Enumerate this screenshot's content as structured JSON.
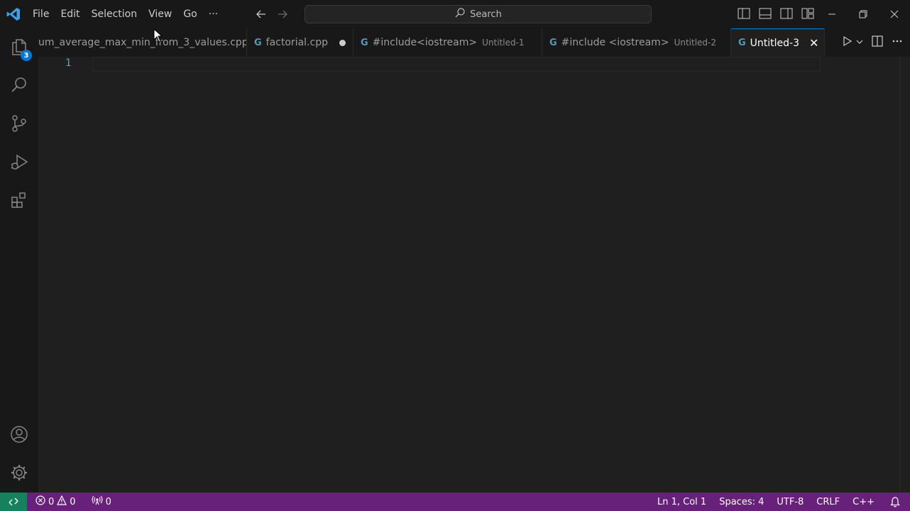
{
  "titlebar": {
    "menu": [
      "File",
      "Edit",
      "Selection",
      "View",
      "Go",
      "···"
    ],
    "search_label": "Search"
  },
  "activitybar": {
    "explorer_badge": "3"
  },
  "tabs": [
    {
      "label": "um_average_max_min_from_3_values.cpp",
      "description": "",
      "dirty": false,
      "active": false
    },
    {
      "label": "factorial.cpp",
      "description": "",
      "dirty": true,
      "active": false
    },
    {
      "label": "#include<iostream>",
      "description": "Untitled-1",
      "dirty": true,
      "active": false
    },
    {
      "label": "#include <iostream>",
      "description": "Untitled-2",
      "dirty": true,
      "active": false
    },
    {
      "label": "Untitled-3",
      "description": "",
      "dirty": false,
      "active": true
    }
  ],
  "tab_icon_glyph": "G",
  "tab_close_glyph": "✕",
  "editor": {
    "line_numbers": [
      "1"
    ]
  },
  "statusbar": {
    "errors": "0",
    "warnings": "0",
    "ports": "0",
    "position": "Ln 1, Col 1",
    "spaces": "Spaces: 4",
    "encoding": "UTF-8",
    "eol": "CRLF",
    "language": "C++"
  },
  "colors": {
    "accent": "#0078d4",
    "statusbar": "#68217a",
    "remote": "#16825d",
    "cpp_icon": "#519aba"
  }
}
